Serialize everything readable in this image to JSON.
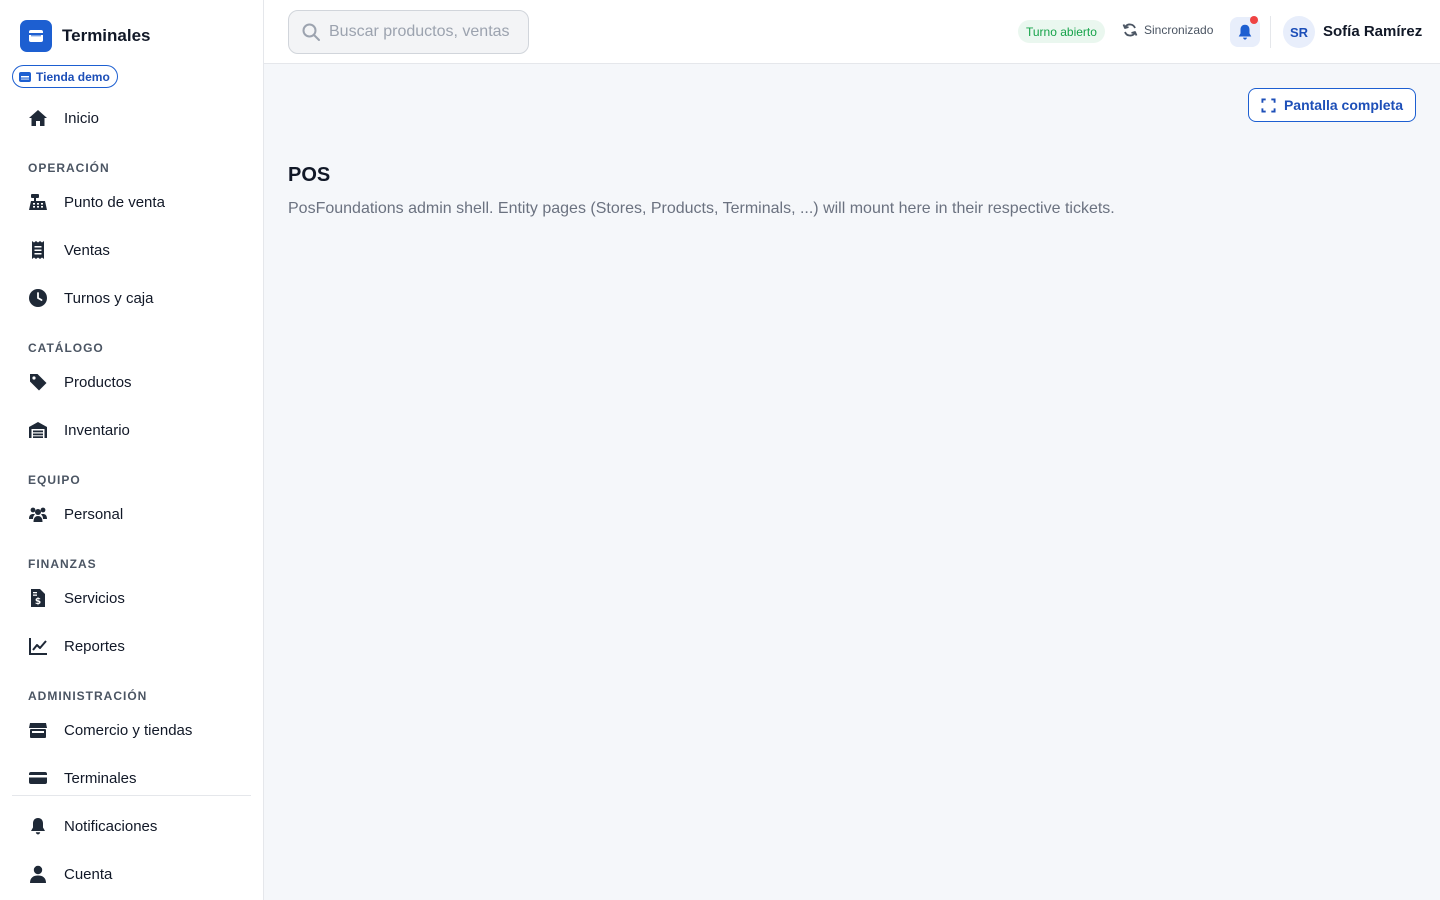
{
  "app": {
    "title": "Terminales",
    "store": "Tienda demo"
  },
  "sidebar": {
    "home": "Inicio",
    "sections": {
      "operacion": "OPERACIÓN",
      "catalogo": "CATÁLOGO",
      "equipo": "EQUIPO",
      "finanzas": "FINANZAS",
      "administracion": "ADMINISTRACIÓN"
    },
    "items": {
      "pos": "Punto de venta",
      "sales": "Ventas",
      "shifts": "Turnos y caja",
      "products": "Productos",
      "inventory": "Inventario",
      "staff": "Personal",
      "services": "Servicios",
      "reports": "Reportes",
      "stores": "Comercio y tiendas",
      "terminals": "Terminales",
      "notifications": "Notificaciones",
      "account": "Cuenta"
    }
  },
  "topbar": {
    "search_placeholder": "Buscar productos, ventas",
    "shift_status": "Turno abierto",
    "sync_status": "Sincronizado",
    "user_initials": "SR",
    "user_name": "Sofía Ramírez"
  },
  "main": {
    "fullscreen_label": "Pantalla completa",
    "title": "POS",
    "description": "PosFoundations admin shell. Entity pages (Stores, Products, Terminals, ...) will mount here in their respective tickets."
  },
  "colors": {
    "accent": "#1d5fd1",
    "success": "#16a34a",
    "alert": "#ef4444"
  }
}
